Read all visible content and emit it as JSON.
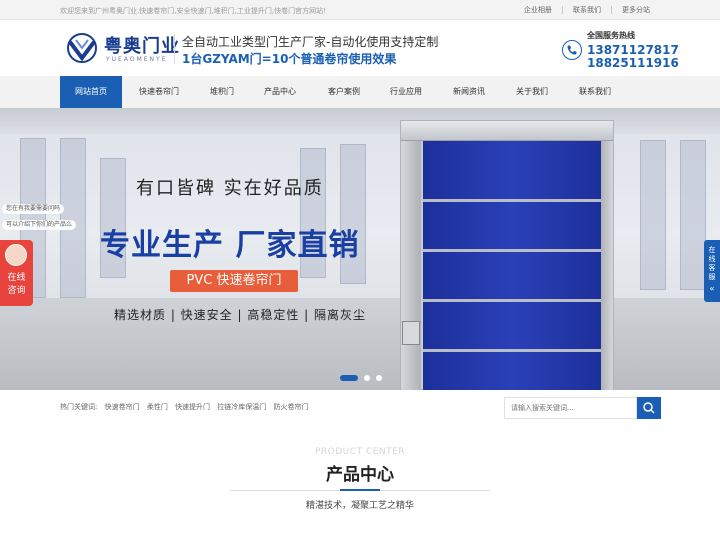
{
  "topbar": {
    "welcome": "欢迎您来到广州粤奥门业,快速卷帘门,安全快速门,堆积门,工业提升门,快卷门官方网站!",
    "links": [
      "企业相册",
      "联系我们",
      "更多分站"
    ]
  },
  "header": {
    "logo_cn": "粤奥门业",
    "logo_en": "YUEAOMENYE",
    "slogan1": "全自动工业类型门生产厂家-自动化使用支持定制",
    "slogan2": "1台GZYAM门=10个普通卷帘使用效果",
    "hotline_label": "全国服务热线",
    "phone1": "13871127817",
    "phone2": "18825111916"
  },
  "nav": {
    "items": [
      "网站首页",
      "快速卷帘门",
      "堆积门",
      "产品中心",
      "客户案例",
      "行业应用",
      "新闻资讯",
      "关于我们",
      "联系我们"
    ],
    "active": 0
  },
  "banner": {
    "headline": "有口皆碑  实在好品质",
    "main": "专业生产 厂家直销",
    "tag": "PVC 快速卷帘门",
    "features": "精选材质 | 快速安全 | 高稳定性 | 隔离灰尘",
    "active_slide": 0,
    "slide_count": 3
  },
  "chat": {
    "bubble1": "您在有我要需要问吗",
    "bubble2": "可以介绍下你们的产品么",
    "button": [
      "在线",
      "咨询"
    ]
  },
  "side_service": [
    "在",
    "线",
    "客",
    "服"
  ],
  "search": {
    "hot_label": "热门关键词:",
    "keywords": [
      "快速卷帘门",
      "柔性门",
      "快速提升门",
      "拉链冷库保温门",
      "防火卷帘门"
    ],
    "placeholder": "请输入搜索关键词..."
  },
  "product_center": {
    "en": "PRODUCT CENTER",
    "cn": "产品中心",
    "sub": "精湛技术，凝聚工艺之精华"
  },
  "colors": {
    "brand": "#1a5fb4",
    "accent": "#e85d3a",
    "chat": "#e8433c",
    "door": "#2a40b8"
  }
}
